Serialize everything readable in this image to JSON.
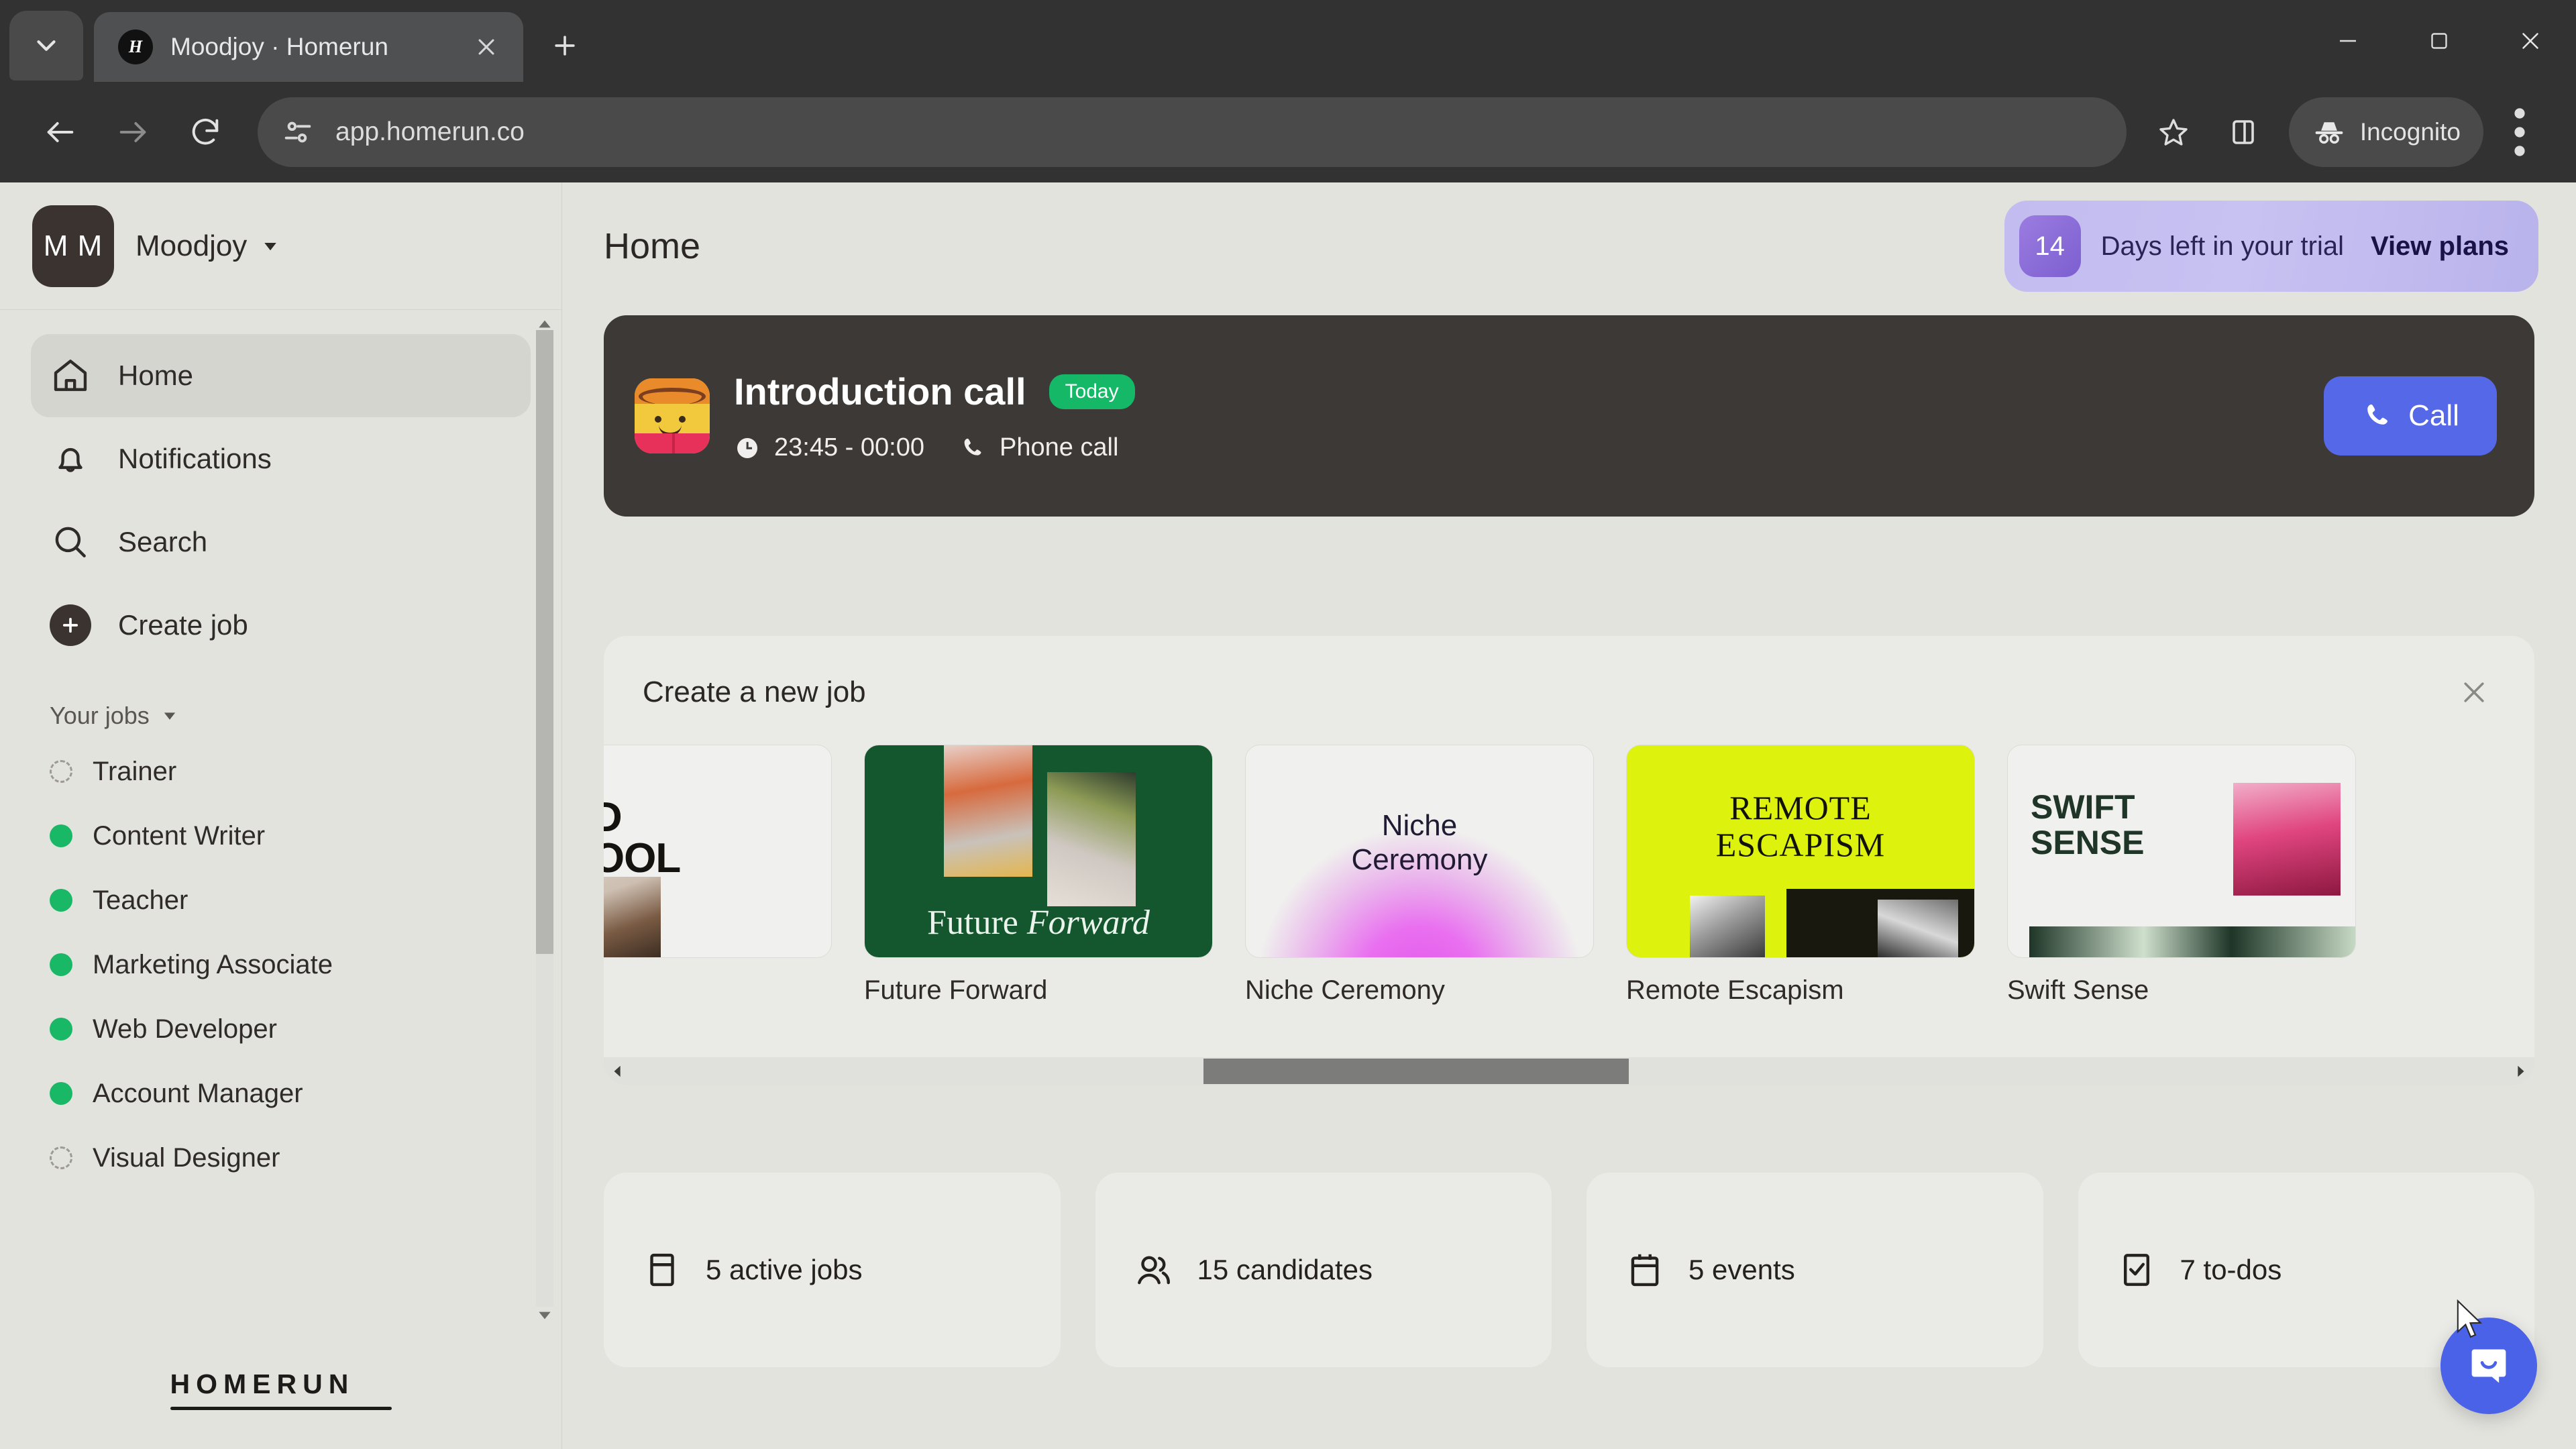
{
  "browser": {
    "tab": {
      "title": "Moodjoy · Homerun",
      "favicon_letter": "H"
    },
    "tab_search_icon": "chevron-down-icon",
    "new_tab_icon": "plus-icon",
    "close_tab_icon": "close-icon",
    "nav": {
      "back": "back-arrow-icon",
      "forward": "forward-arrow-icon",
      "reload": "reload-icon"
    },
    "omnibox": {
      "url": "app.homerun.co",
      "site_settings_icon": "tune-icon"
    },
    "actions": {
      "bookmark": "star-icon",
      "side_panel": "side-panel-icon",
      "profile_label": "Incognito",
      "menu": "three-dot-menu-icon"
    },
    "window": {
      "minimize": "minimize-icon",
      "maximize": "maximize-icon",
      "close": "close-icon"
    }
  },
  "sidebar": {
    "org": {
      "initials": "M M",
      "name": "Moodjoy"
    },
    "nav": [
      {
        "label": "Home",
        "icon": "home-icon",
        "active": true
      },
      {
        "label": "Notifications",
        "icon": "bell-icon",
        "active": false
      },
      {
        "label": "Search",
        "icon": "search-icon",
        "active": false
      },
      {
        "label": "Create job",
        "icon": "plus-circle-icon",
        "active": false
      }
    ],
    "jobs_section_label": "Your jobs",
    "jobs": [
      {
        "label": "Trainer",
        "status": "draft"
      },
      {
        "label": "Content Writer",
        "status": "live"
      },
      {
        "label": "Teacher",
        "status": "live"
      },
      {
        "label": "Marketing Associate",
        "status": "live"
      },
      {
        "label": "Web Developer",
        "status": "live"
      },
      {
        "label": "Account Manager",
        "status": "live"
      },
      {
        "label": "Visual Designer",
        "status": "draft"
      }
    ],
    "brand": "HOMERUN"
  },
  "header": {
    "title": "Home",
    "trial": {
      "days": "14",
      "text": "Days left in your trial",
      "link": "View plans"
    }
  },
  "call_card": {
    "title": "Introduction call",
    "badge": "Today",
    "time": "23:45 - 00:00",
    "type": "Phone call",
    "button": "Call",
    "button_color": "#5468e8",
    "badge_color": "#15b866"
  },
  "new_job": {
    "heading": "Create a new job",
    "close_icon": "close-icon",
    "templates": [
      {
        "name": "",
        "art_line1": "BOLD",
        "art_line2": "SCHOOL",
        "style": "bold"
      },
      {
        "name": "Future Forward",
        "art_line1": "Future",
        "art_line2": "Forward",
        "style": "green"
      },
      {
        "name": "Niche Ceremony",
        "art_line1": "Niche",
        "art_line2": "Ceremony",
        "style": "niche"
      },
      {
        "name": "Remote Escapism",
        "art_line1": "REMOTE",
        "art_line2": "ESCAPISM",
        "style": "lime"
      },
      {
        "name": "Swift Sense",
        "art_line1": "SWIFT",
        "art_line2": "SENSE",
        "style": "swift"
      }
    ]
  },
  "stats": [
    {
      "label": "5 active jobs",
      "icon": "jobs-icon"
    },
    {
      "label": "15 candidates",
      "icon": "people-icon"
    },
    {
      "label": "5 events",
      "icon": "calendar-icon"
    },
    {
      "label": "7 to-dos",
      "icon": "checkbox-icon"
    }
  ],
  "intercom": {
    "icon": "chat-bubble-icon",
    "color": "#4a62e8"
  }
}
